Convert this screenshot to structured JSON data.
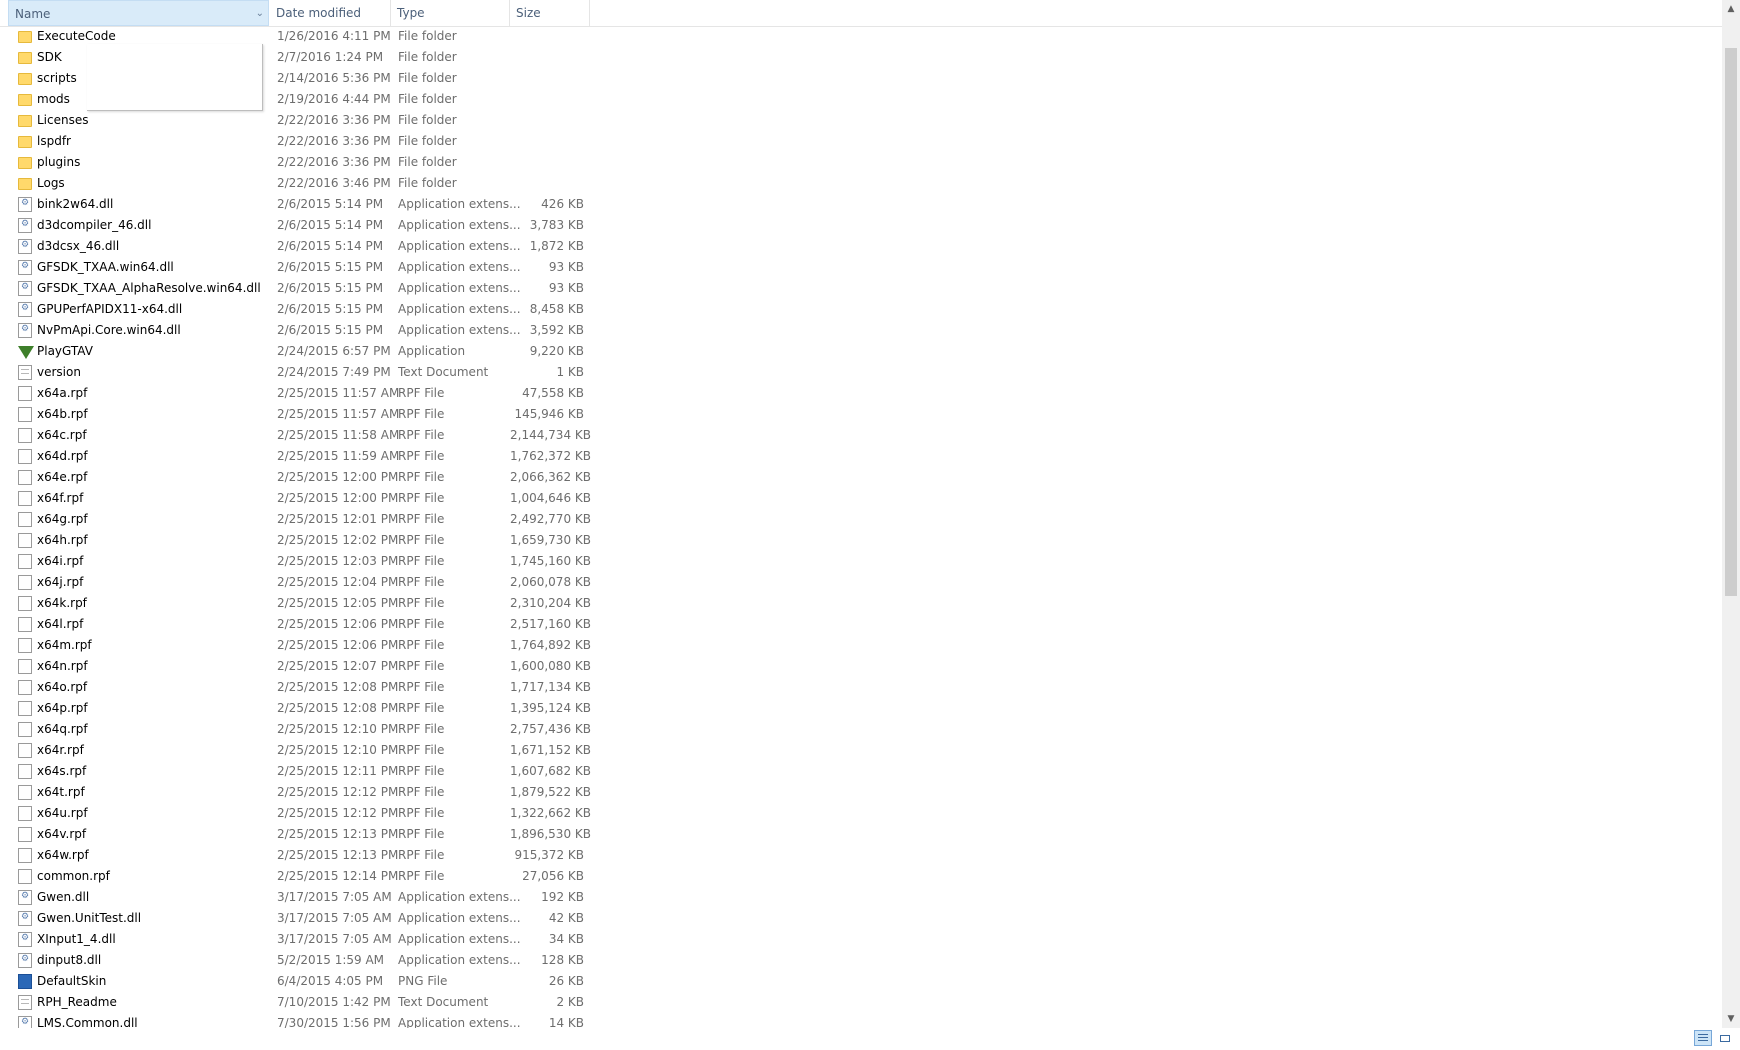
{
  "header": {
    "name": "Name",
    "date_modified": "Date modified",
    "type": "Type",
    "size": "Size"
  },
  "icons": {
    "folder": "folder-icon",
    "dll": "dll-file-icon",
    "file": "file-icon",
    "text": "text-document-icon",
    "app": "application-icon",
    "png": "png-image-icon"
  },
  "files": [
    {
      "name": "ExecuteCode",
      "date": "1/26/2016 4:11 PM",
      "type": "File folder",
      "size": "",
      "icon": "folder"
    },
    {
      "name": "SDK",
      "date": "2/7/2016 1:24 PM",
      "type": "File folder",
      "size": "",
      "icon": "folder"
    },
    {
      "name": "scripts",
      "date": "2/14/2016 5:36 PM",
      "type": "File folder",
      "size": "",
      "icon": "folder"
    },
    {
      "name": "mods",
      "date": "2/19/2016 4:44 PM",
      "type": "File folder",
      "size": "",
      "icon": "folder"
    },
    {
      "name": "Licenses",
      "date": "2/22/2016 3:36 PM",
      "type": "File folder",
      "size": "",
      "icon": "folder"
    },
    {
      "name": "lspdfr",
      "date": "2/22/2016 3:36 PM",
      "type": "File folder",
      "size": "",
      "icon": "folder"
    },
    {
      "name": "plugins",
      "date": "2/22/2016 3:36 PM",
      "type": "File folder",
      "size": "",
      "icon": "folder"
    },
    {
      "name": "Logs",
      "date": "2/22/2016 3:46 PM",
      "type": "File folder",
      "size": "",
      "icon": "folder"
    },
    {
      "name": "bink2w64.dll",
      "date": "2/6/2015 5:14 PM",
      "type": "Application extens...",
      "size": "426 KB",
      "icon": "dll"
    },
    {
      "name": "d3dcompiler_46.dll",
      "date": "2/6/2015 5:14 PM",
      "type": "Application extens...",
      "size": "3,783 KB",
      "icon": "dll"
    },
    {
      "name": "d3dcsx_46.dll",
      "date": "2/6/2015 5:14 PM",
      "type": "Application extens...",
      "size": "1,872 KB",
      "icon": "dll"
    },
    {
      "name": "GFSDK_TXAA.win64.dll",
      "date": "2/6/2015 5:15 PM",
      "type": "Application extens...",
      "size": "93 KB",
      "icon": "dll"
    },
    {
      "name": "GFSDK_TXAA_AlphaResolve.win64.dll",
      "date": "2/6/2015 5:15 PM",
      "type": "Application extens...",
      "size": "93 KB",
      "icon": "dll"
    },
    {
      "name": "GPUPerfAPIDX11-x64.dll",
      "date": "2/6/2015 5:15 PM",
      "type": "Application extens...",
      "size": "8,458 KB",
      "icon": "dll"
    },
    {
      "name": "NvPmApi.Core.win64.dll",
      "date": "2/6/2015 5:15 PM",
      "type": "Application extens...",
      "size": "3,592 KB",
      "icon": "dll"
    },
    {
      "name": "PlayGTAV",
      "date": "2/24/2015 6:57 PM",
      "type": "Application",
      "size": "9,220 KB",
      "icon": "app"
    },
    {
      "name": "version",
      "date": "2/24/2015 7:49 PM",
      "type": "Text Document",
      "size": "1 KB",
      "icon": "text"
    },
    {
      "name": "x64a.rpf",
      "date": "2/25/2015 11:57 AM",
      "type": "RPF File",
      "size": "47,558 KB",
      "icon": "file"
    },
    {
      "name": "x64b.rpf",
      "date": "2/25/2015 11:57 AM",
      "type": "RPF File",
      "size": "145,946 KB",
      "icon": "file"
    },
    {
      "name": "x64c.rpf",
      "date": "2/25/2015 11:58 AM",
      "type": "RPF File",
      "size": "2,144,734 KB",
      "icon": "file"
    },
    {
      "name": "x64d.rpf",
      "date": "2/25/2015 11:59 AM",
      "type": "RPF File",
      "size": "1,762,372 KB",
      "icon": "file"
    },
    {
      "name": "x64e.rpf",
      "date": "2/25/2015 12:00 PM",
      "type": "RPF File",
      "size": "2,066,362 KB",
      "icon": "file"
    },
    {
      "name": "x64f.rpf",
      "date": "2/25/2015 12:00 PM",
      "type": "RPF File",
      "size": "1,004,646 KB",
      "icon": "file"
    },
    {
      "name": "x64g.rpf",
      "date": "2/25/2015 12:01 PM",
      "type": "RPF File",
      "size": "2,492,770 KB",
      "icon": "file"
    },
    {
      "name": "x64h.rpf",
      "date": "2/25/2015 12:02 PM",
      "type": "RPF File",
      "size": "1,659,730 KB",
      "icon": "file"
    },
    {
      "name": "x64i.rpf",
      "date": "2/25/2015 12:03 PM",
      "type": "RPF File",
      "size": "1,745,160 KB",
      "icon": "file"
    },
    {
      "name": "x64j.rpf",
      "date": "2/25/2015 12:04 PM",
      "type": "RPF File",
      "size": "2,060,078 KB",
      "icon": "file"
    },
    {
      "name": "x64k.rpf",
      "date": "2/25/2015 12:05 PM",
      "type": "RPF File",
      "size": "2,310,204 KB",
      "icon": "file"
    },
    {
      "name": "x64l.rpf",
      "date": "2/25/2015 12:06 PM",
      "type": "RPF File",
      "size": "2,517,160 KB",
      "icon": "file"
    },
    {
      "name": "x64m.rpf",
      "date": "2/25/2015 12:06 PM",
      "type": "RPF File",
      "size": "1,764,892 KB",
      "icon": "file"
    },
    {
      "name": "x64n.rpf",
      "date": "2/25/2015 12:07 PM",
      "type": "RPF File",
      "size": "1,600,080 KB",
      "icon": "file"
    },
    {
      "name": "x64o.rpf",
      "date": "2/25/2015 12:08 PM",
      "type": "RPF File",
      "size": "1,717,134 KB",
      "icon": "file"
    },
    {
      "name": "x64p.rpf",
      "date": "2/25/2015 12:08 PM",
      "type": "RPF File",
      "size": "1,395,124 KB",
      "icon": "file"
    },
    {
      "name": "x64q.rpf",
      "date": "2/25/2015 12:10 PM",
      "type": "RPF File",
      "size": "2,757,436 KB",
      "icon": "file"
    },
    {
      "name": "x64r.rpf",
      "date": "2/25/2015 12:10 PM",
      "type": "RPF File",
      "size": "1,671,152 KB",
      "icon": "file"
    },
    {
      "name": "x64s.rpf",
      "date": "2/25/2015 12:11 PM",
      "type": "RPF File",
      "size": "1,607,682 KB",
      "icon": "file"
    },
    {
      "name": "x64t.rpf",
      "date": "2/25/2015 12:12 PM",
      "type": "RPF File",
      "size": "1,879,522 KB",
      "icon": "file"
    },
    {
      "name": "x64u.rpf",
      "date": "2/25/2015 12:12 PM",
      "type": "RPF File",
      "size": "1,322,662 KB",
      "icon": "file"
    },
    {
      "name": "x64v.rpf",
      "date": "2/25/2015 12:13 PM",
      "type": "RPF File",
      "size": "1,896,530 KB",
      "icon": "file"
    },
    {
      "name": "x64w.rpf",
      "date": "2/25/2015 12:13 PM",
      "type": "RPF File",
      "size": "915,372 KB",
      "icon": "file"
    },
    {
      "name": "common.rpf",
      "date": "2/25/2015 12:14 PM",
      "type": "RPF File",
      "size": "27,056 KB",
      "icon": "file"
    },
    {
      "name": "Gwen.dll",
      "date": "3/17/2015 7:05 AM",
      "type": "Application extens...",
      "size": "192 KB",
      "icon": "dll"
    },
    {
      "name": "Gwen.UnitTest.dll",
      "date": "3/17/2015 7:05 AM",
      "type": "Application extens...",
      "size": "42 KB",
      "icon": "dll"
    },
    {
      "name": "XInput1_4.dll",
      "date": "3/17/2015 7:05 AM",
      "type": "Application extens...",
      "size": "34 KB",
      "icon": "dll"
    },
    {
      "name": "dinput8.dll",
      "date": "5/2/2015 1:59 AM",
      "type": "Application extens...",
      "size": "128 KB",
      "icon": "dll"
    },
    {
      "name": "DefaultSkin",
      "date": "6/4/2015 4:05 PM",
      "type": "PNG File",
      "size": "26 KB",
      "icon": "png"
    },
    {
      "name": "RPH_Readme",
      "date": "7/10/2015 1:42 PM",
      "type": "Text Document",
      "size": "2 KB",
      "icon": "text"
    },
    {
      "name": "LMS.Common.dll",
      "date": "7/30/2015 1:56 PM",
      "type": "Application extens...",
      "size": "14 KB",
      "icon": "dll"
    }
  ]
}
